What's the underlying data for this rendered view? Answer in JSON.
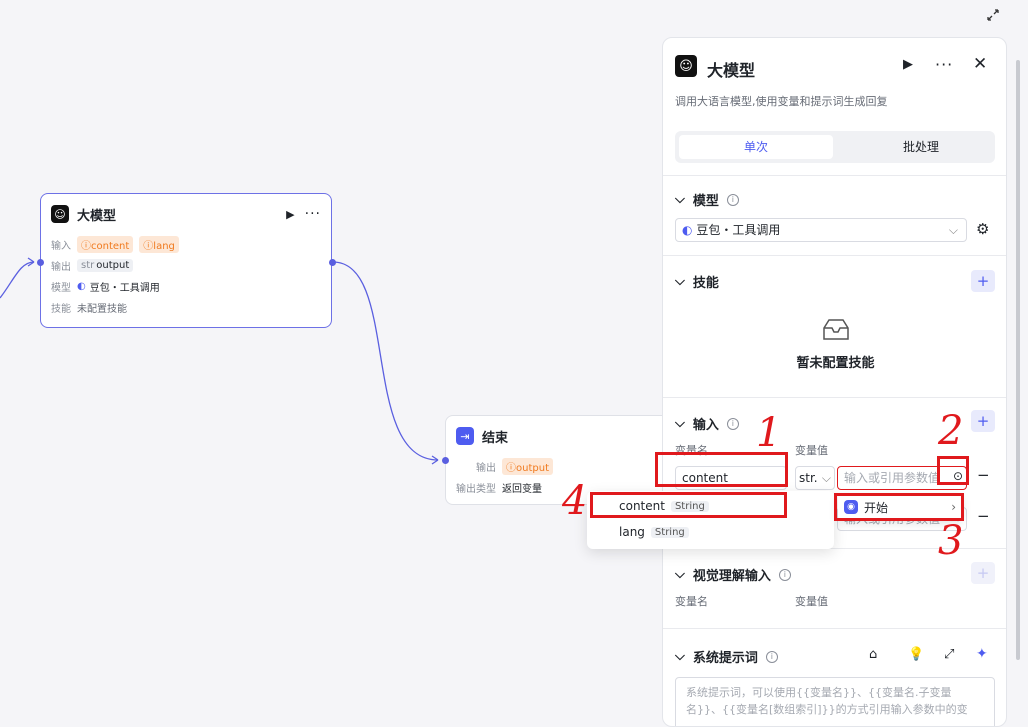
{
  "canvas": {
    "llm_node": {
      "title": "大模型",
      "input_label": "输入",
      "inputs": [
        "content",
        "lang"
      ],
      "output_label": "输出",
      "output_type": "str",
      "output_name": "output",
      "model_label": "模型",
      "model_name": "豆包・工具调用",
      "skill_label": "技能",
      "skill_value": "未配置技能"
    },
    "end_node": {
      "title": "结束",
      "output_label": "输出",
      "output_name": "output",
      "output_type_label": "输出类型",
      "output_type_value": "返回变量"
    }
  },
  "panel": {
    "title": "大模型",
    "description": "调用大语言模型,使用变量和提示词生成回复",
    "tabs": [
      "单次",
      "批处理"
    ],
    "model_section": {
      "title": "模型",
      "selected_model": "豆包・工具调用"
    },
    "skill_section": {
      "title": "技能",
      "empty_text": "暂未配置技能"
    },
    "input_section": {
      "title": "输入",
      "col_name": "变量名",
      "col_value": "变量值",
      "row1_name": "content",
      "row1_type": "str.",
      "value_placeholder": "输入或引用参数值"
    },
    "vision_section": {
      "title": "视觉理解输入",
      "col_name": "变量名",
      "col_value": "变量值"
    },
    "system_prompt": {
      "title": "系统提示词",
      "placeholder_line1": "系统提示词，可以使用{{变量名}}、{{变量名.子变量",
      "placeholder_line2": "名}}、{{变量名[数组索引]}}的方式引用输入参数中的变"
    }
  },
  "popup": {
    "submenu_label": "开始",
    "items": [
      {
        "name": "content",
        "type": "String"
      },
      {
        "name": "lang",
        "type": "String"
      }
    ]
  },
  "annotations": [
    "1",
    "2",
    "3",
    "4"
  ],
  "colors": {
    "accent": "#4e5cf0",
    "annotation_red": "#e0191d",
    "tag_orange": "#f07a1f"
  }
}
